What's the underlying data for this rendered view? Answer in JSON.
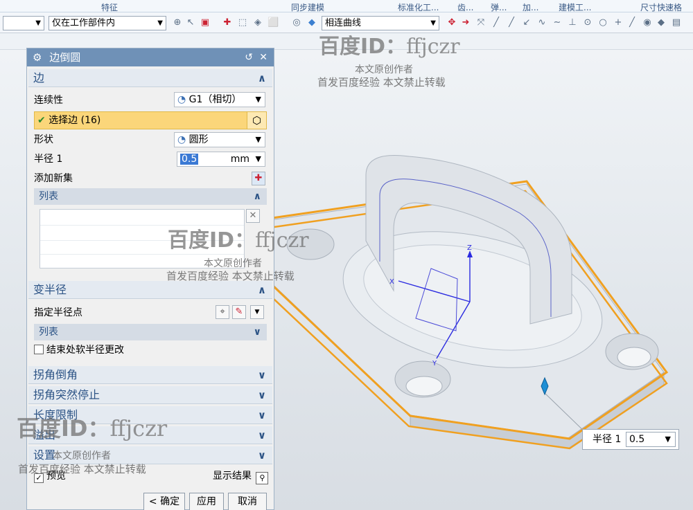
{
  "ribbon": {
    "groups": [
      "特征",
      "同步建模",
      "标准化工...",
      "齿...",
      "弹...",
      "加...",
      "建模工...",
      "尺寸快速格"
    ]
  },
  "toolbar": {
    "filter_value": "",
    "scope_value": "仅在工作部件内",
    "curve_rule_value": "相连曲线"
  },
  "dialog": {
    "title": "边倒圆",
    "edge_section": {
      "title": "边",
      "continuity_label": "连续性",
      "continuity_value": "G1（相切）",
      "select_edge_label": "选择边 (16)",
      "shape_label": "形状",
      "shape_value": "圆形",
      "radius_label": "半径 1",
      "radius_value": "0.5",
      "radius_unit": "mm",
      "add_set_label": "添加新集",
      "list_label": "列表"
    },
    "variable_section": {
      "title": "变半径",
      "point_label": "指定半径点",
      "list_label": "列表",
      "soft_label": "结束处软半径更改"
    },
    "collapsed_sections": [
      "拐角倒角",
      "拐角突然停止",
      "长度限制",
      "溢出",
      "设置"
    ],
    "preview_label": "预览",
    "show_result_label": "显示结果",
    "ok_label": "< 确定 >",
    "apply_label": "应用",
    "cancel_label": "取消"
  },
  "float_radius": {
    "label": "半径 1",
    "value": "0.5"
  },
  "axis_labels": {
    "z": "Z",
    "x": "X",
    "y": "Y"
  },
  "watermarks": {
    "id_prefix": "百度ID：",
    "id_name": "ffjczr",
    "line1": "本文原创作者",
    "line2": "首发百度经验   本文禁止转载"
  },
  "colors": {
    "title_bar": "#6f91b7",
    "selection_highlight": "#fbd67a",
    "edge_highlight": "#f0a020",
    "section_text": "#2d5486"
  },
  "icons": [
    "settings-icon",
    "reset-icon",
    "close-icon",
    "cube-icon",
    "add-set-icon",
    "delete-icon",
    "point-icon",
    "magnifier-icon"
  ]
}
